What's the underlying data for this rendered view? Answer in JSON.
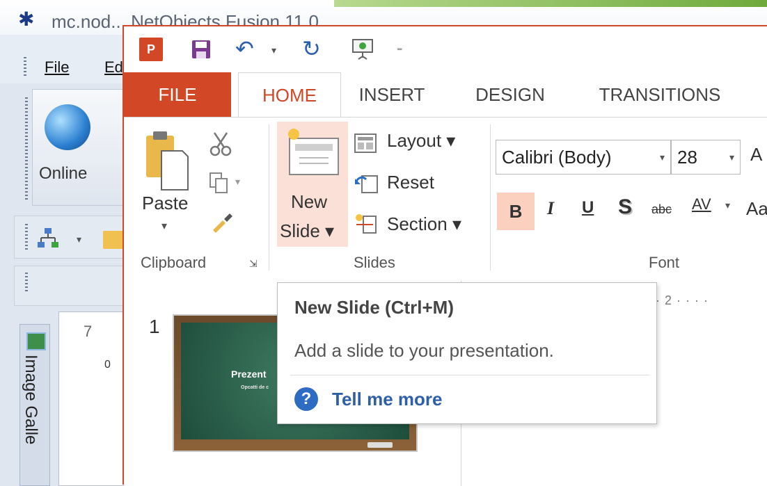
{
  "background_app": {
    "title": "mc.nod... NetObjects Fusion 11.0",
    "menu": {
      "file": "File",
      "edit": "Ed"
    },
    "online_label": "Online",
    "ruler_number": "7",
    "ruler_zero": "0",
    "side_panel_label": "Image Galle"
  },
  "powerpoint": {
    "logo_text": "P",
    "tabs": [
      {
        "label": "FILE"
      },
      {
        "label": "HOME"
      },
      {
        "label": "INSERT"
      },
      {
        "label": "DESIGN"
      },
      {
        "label": "TRANSITIONS"
      }
    ],
    "clipboard": {
      "paste_label": "Paste",
      "paste_arrow": "▾",
      "group_label": "Clipboard",
      "launcher": "⇲"
    },
    "slides": {
      "new_slide_line1": "New",
      "new_slide_line2": "Slide ▾",
      "layout_label": "Layout ▾",
      "reset_label": "Reset",
      "section_label": "Section ▾",
      "group_label": "Slides"
    },
    "font": {
      "font_name": "Calibri (Body)",
      "font_size": "28",
      "grow_glyph": "A",
      "bold": "B",
      "italic": "I",
      "underline": "U",
      "shadow": "S",
      "strike": "abc",
      "spacing": "AV",
      "case": "Aa",
      "group_label": "Font"
    },
    "slide_panel": {
      "slide_number": "1",
      "thumbnail_title": "Prezent",
      "thumbnail_subtitle": "Opcatti de c"
    },
    "ruler_text": "· 2 · · · ·",
    "tooltip": {
      "title": "New Slide (Ctrl+M)",
      "description": "Add a slide to your presentation.",
      "link": "Tell me more",
      "help_icon": "?"
    }
  },
  "colors": {
    "accent": "#d24726",
    "link": "#2e5fa8",
    "highlight": "#fbd0bf"
  }
}
